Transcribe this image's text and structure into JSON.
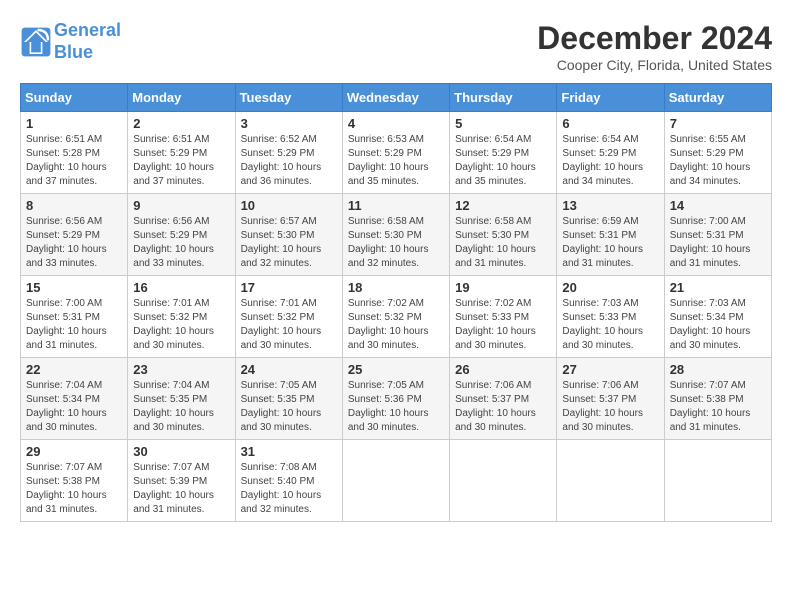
{
  "logo": {
    "line1": "General",
    "line2": "Blue"
  },
  "title": "December 2024",
  "location": "Cooper City, Florida, United States",
  "weekdays": [
    "Sunday",
    "Monday",
    "Tuesday",
    "Wednesday",
    "Thursday",
    "Friday",
    "Saturday"
  ],
  "weeks": [
    [
      {
        "day": "1",
        "sunrise": "6:51 AM",
        "sunset": "5:28 PM",
        "daylight": "10 hours and 37 minutes."
      },
      {
        "day": "2",
        "sunrise": "6:51 AM",
        "sunset": "5:29 PM",
        "daylight": "10 hours and 37 minutes."
      },
      {
        "day": "3",
        "sunrise": "6:52 AM",
        "sunset": "5:29 PM",
        "daylight": "10 hours and 36 minutes."
      },
      {
        "day": "4",
        "sunrise": "6:53 AM",
        "sunset": "5:29 PM",
        "daylight": "10 hours and 35 minutes."
      },
      {
        "day": "5",
        "sunrise": "6:54 AM",
        "sunset": "5:29 PM",
        "daylight": "10 hours and 35 minutes."
      },
      {
        "day": "6",
        "sunrise": "6:54 AM",
        "sunset": "5:29 PM",
        "daylight": "10 hours and 34 minutes."
      },
      {
        "day": "7",
        "sunrise": "6:55 AM",
        "sunset": "5:29 PM",
        "daylight": "10 hours and 34 minutes."
      }
    ],
    [
      {
        "day": "8",
        "sunrise": "6:56 AM",
        "sunset": "5:29 PM",
        "daylight": "10 hours and 33 minutes."
      },
      {
        "day": "9",
        "sunrise": "6:56 AM",
        "sunset": "5:29 PM",
        "daylight": "10 hours and 33 minutes."
      },
      {
        "day": "10",
        "sunrise": "6:57 AM",
        "sunset": "5:30 PM",
        "daylight": "10 hours and 32 minutes."
      },
      {
        "day": "11",
        "sunrise": "6:58 AM",
        "sunset": "5:30 PM",
        "daylight": "10 hours and 32 minutes."
      },
      {
        "day": "12",
        "sunrise": "6:58 AM",
        "sunset": "5:30 PM",
        "daylight": "10 hours and 31 minutes."
      },
      {
        "day": "13",
        "sunrise": "6:59 AM",
        "sunset": "5:31 PM",
        "daylight": "10 hours and 31 minutes."
      },
      {
        "day": "14",
        "sunrise": "7:00 AM",
        "sunset": "5:31 PM",
        "daylight": "10 hours and 31 minutes."
      }
    ],
    [
      {
        "day": "15",
        "sunrise": "7:00 AM",
        "sunset": "5:31 PM",
        "daylight": "10 hours and 31 minutes."
      },
      {
        "day": "16",
        "sunrise": "7:01 AM",
        "sunset": "5:32 PM",
        "daylight": "10 hours and 30 minutes."
      },
      {
        "day": "17",
        "sunrise": "7:01 AM",
        "sunset": "5:32 PM",
        "daylight": "10 hours and 30 minutes."
      },
      {
        "day": "18",
        "sunrise": "7:02 AM",
        "sunset": "5:32 PM",
        "daylight": "10 hours and 30 minutes."
      },
      {
        "day": "19",
        "sunrise": "7:02 AM",
        "sunset": "5:33 PM",
        "daylight": "10 hours and 30 minutes."
      },
      {
        "day": "20",
        "sunrise": "7:03 AM",
        "sunset": "5:33 PM",
        "daylight": "10 hours and 30 minutes."
      },
      {
        "day": "21",
        "sunrise": "7:03 AM",
        "sunset": "5:34 PM",
        "daylight": "10 hours and 30 minutes."
      }
    ],
    [
      {
        "day": "22",
        "sunrise": "7:04 AM",
        "sunset": "5:34 PM",
        "daylight": "10 hours and 30 minutes."
      },
      {
        "day": "23",
        "sunrise": "7:04 AM",
        "sunset": "5:35 PM",
        "daylight": "10 hours and 30 minutes."
      },
      {
        "day": "24",
        "sunrise": "7:05 AM",
        "sunset": "5:35 PM",
        "daylight": "10 hours and 30 minutes."
      },
      {
        "day": "25",
        "sunrise": "7:05 AM",
        "sunset": "5:36 PM",
        "daylight": "10 hours and 30 minutes."
      },
      {
        "day": "26",
        "sunrise": "7:06 AM",
        "sunset": "5:37 PM",
        "daylight": "10 hours and 30 minutes."
      },
      {
        "day": "27",
        "sunrise": "7:06 AM",
        "sunset": "5:37 PM",
        "daylight": "10 hours and 30 minutes."
      },
      {
        "day": "28",
        "sunrise": "7:07 AM",
        "sunset": "5:38 PM",
        "daylight": "10 hours and 31 minutes."
      }
    ],
    [
      {
        "day": "29",
        "sunrise": "7:07 AM",
        "sunset": "5:38 PM",
        "daylight": "10 hours and 31 minutes."
      },
      {
        "day": "30",
        "sunrise": "7:07 AM",
        "sunset": "5:39 PM",
        "daylight": "10 hours and 31 minutes."
      },
      {
        "day": "31",
        "sunrise": "7:08 AM",
        "sunset": "5:40 PM",
        "daylight": "10 hours and 32 minutes."
      },
      null,
      null,
      null,
      null
    ]
  ]
}
